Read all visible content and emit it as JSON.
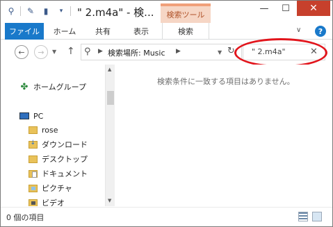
{
  "titlebar": {
    "title": "\" 2.m4a\" - 検...",
    "context_tab": "検索ツール",
    "minimize": "—",
    "maximize": "☐",
    "close": "✕"
  },
  "ribbon": {
    "tabs": [
      "ファイル",
      "ホーム",
      "共有",
      "表示",
      "検索"
    ],
    "expand": "∨",
    "help": "?"
  },
  "address": {
    "path_label": "検索場所: Music",
    "refresh": "↻"
  },
  "search": {
    "value": "\" 2.m4a\"",
    "clear": "✕"
  },
  "nav_pane": {
    "homegroup": "ホームグループ",
    "pc": "PC",
    "items": [
      "rose",
      "ダウンロード",
      "デスクトップ",
      "ドキュメント",
      "ピクチャ",
      "ビデオ"
    ]
  },
  "content": {
    "empty_message": "検索条件に一致する項目はありません。"
  },
  "status": {
    "item_count": "0 個の項目"
  },
  "colors": {
    "file_tab": "#1979ca",
    "context_tab": "#f6d6c5",
    "close_button": "#c7402c",
    "annotation": "#e2151c"
  }
}
